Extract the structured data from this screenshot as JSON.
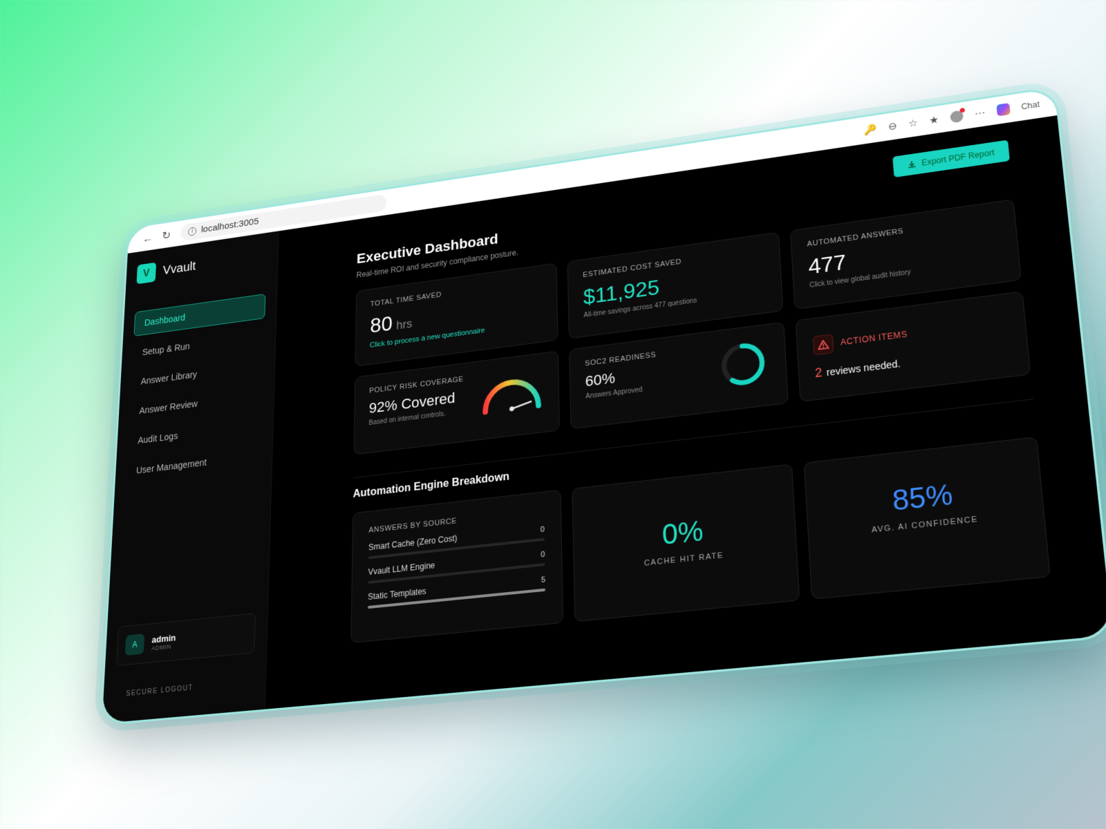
{
  "browser": {
    "url": "localhost:3005",
    "chat_label": "Chat"
  },
  "app": {
    "brand_letter": "V",
    "brand_name": "Vvault"
  },
  "sidebar": {
    "items": [
      {
        "label": "Dashboard",
        "active": true
      },
      {
        "label": "Setup & Run"
      },
      {
        "label": "Answer Library"
      },
      {
        "label": "Answer Review"
      },
      {
        "label": "Audit Logs"
      },
      {
        "label": "User Management"
      }
    ],
    "user": {
      "initial": "A",
      "name": "admin",
      "role": "ADMIN"
    },
    "logout_label": "SECURE LOGOUT"
  },
  "header": {
    "title": "Executive Dashboard",
    "subtitle": "Real-time ROI and security compliance posture.",
    "export_label": "Export PDF Report"
  },
  "kpis": {
    "time_saved": {
      "label": "TOTAL TIME SAVED",
      "value": "80",
      "unit": "hrs",
      "link": "Click to process a new questionnaire"
    },
    "cost_saved": {
      "label": "ESTIMATED COST SAVED",
      "value": "$11,925",
      "note": "All-time savings across 477 questions"
    },
    "automated": {
      "label": "AUTOMATED ANSWERS",
      "value": "477",
      "note": "Click to view global audit history"
    },
    "policy": {
      "label": "POLICY RISK COVERAGE",
      "value": "92% Covered",
      "note": "Based on internal controls.",
      "gauge_fraction": 0.92
    },
    "soc2": {
      "label": "SOC2 READINESS",
      "value": "60%",
      "note": "Answers Approved",
      "progress_fraction": 0.6
    },
    "action": {
      "label": "ACTION ITEMS",
      "count": "2",
      "text": "reviews needed."
    }
  },
  "breakdown": {
    "title": "Automation Engine Breakdown",
    "source_label": "ANSWERS BY SOURCE",
    "sources": [
      {
        "name": "Smart Cache (Zero Cost)",
        "value": "0",
        "fraction": 0
      },
      {
        "name": "Vvault LLM Engine",
        "value": "0",
        "fraction": 0
      },
      {
        "name": "Static Templates",
        "value": "5",
        "fraction": 1
      }
    ],
    "cache": {
      "value": "0%",
      "label": "CACHE HIT RATE"
    },
    "confidence": {
      "value": "85%",
      "label": "AVG. AI CONFIDENCE"
    }
  },
  "colors": {
    "accent": "#19d4c0",
    "teal_text": "#24e2c6",
    "danger": "#ff5b5b",
    "confidence_blue": "#3f8cff"
  }
}
